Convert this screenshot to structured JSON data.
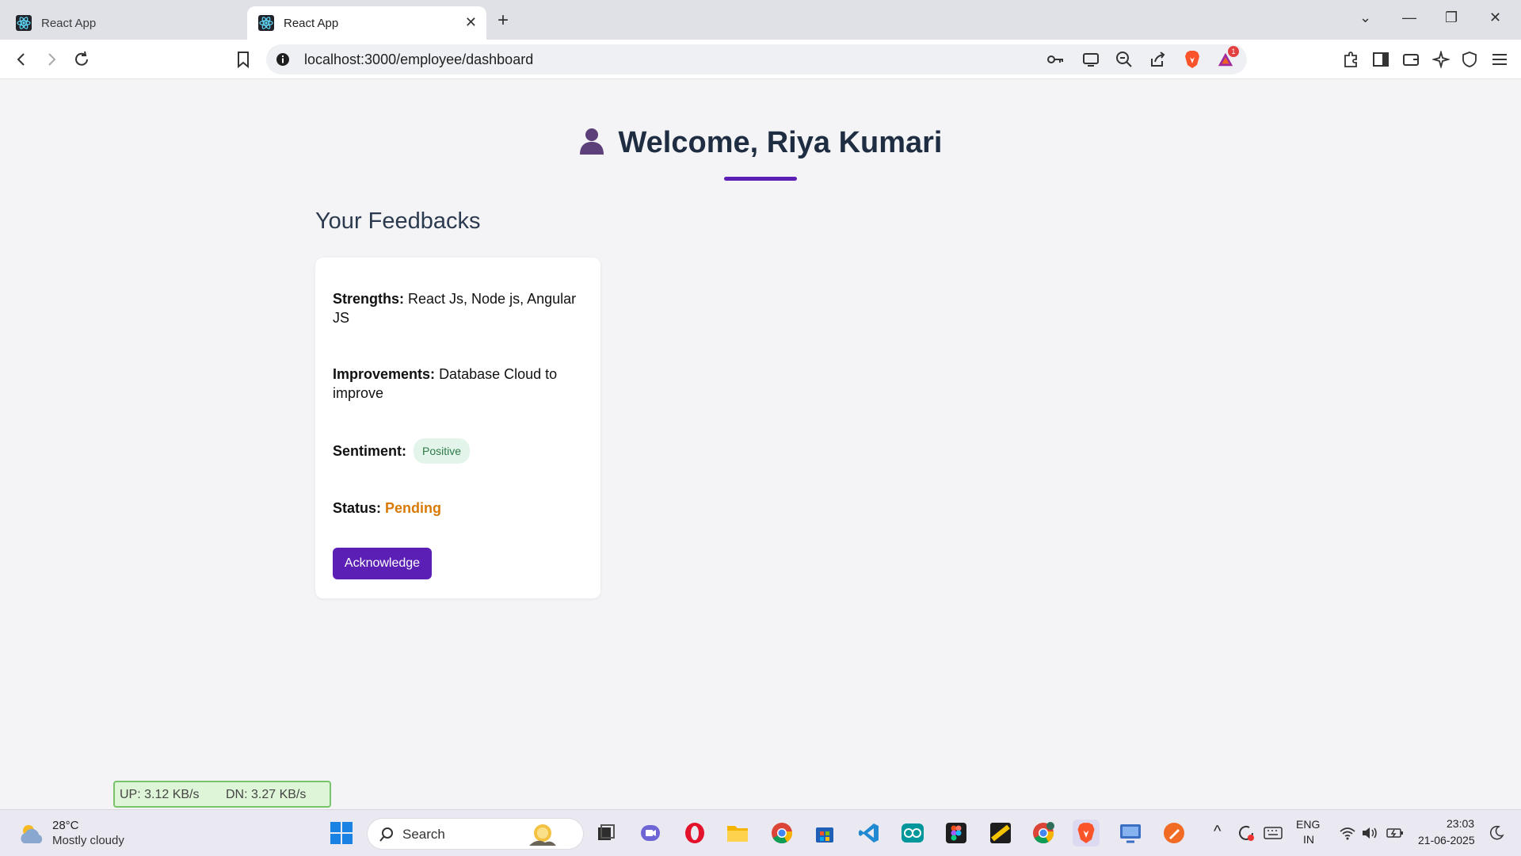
{
  "browser": {
    "tabs": [
      {
        "title": "React App",
        "active": false
      },
      {
        "title": "React App",
        "active": true
      }
    ],
    "url": "localhost:3000/employee/dashboard",
    "brave_rewards_badge": "1"
  },
  "page": {
    "welcome": "Welcome, Riya Kumari",
    "section_title": "Your Feedbacks",
    "feedback": {
      "strengths_label": "Strengths:",
      "strengths_value": "React Js, Node js, Angular JS",
      "improvements_label": "Improvements:",
      "improvements_value": "Database Cloud to improve",
      "sentiment_label": "Sentiment:",
      "sentiment_value": "Positive",
      "status_label": "Status:",
      "status_value": "Pending",
      "acknowledge_label": "Acknowledge"
    }
  },
  "netmeter": {
    "up": "UP: 3.12 KB/s",
    "down": "DN: 3.27 KB/s"
  },
  "taskbar": {
    "weather_temp": "28°C",
    "weather_cond": "Mostly cloudy",
    "search_label": "Search",
    "lang_top": "ENG",
    "lang_bottom": "IN",
    "time": "23:03",
    "date": "21-06-2025"
  },
  "colors": {
    "accent": "#5b1fb5",
    "status_pending": "#d97a06",
    "sentiment_positive_bg": "#e3f4ea",
    "sentiment_positive_text": "#2f7a48"
  }
}
